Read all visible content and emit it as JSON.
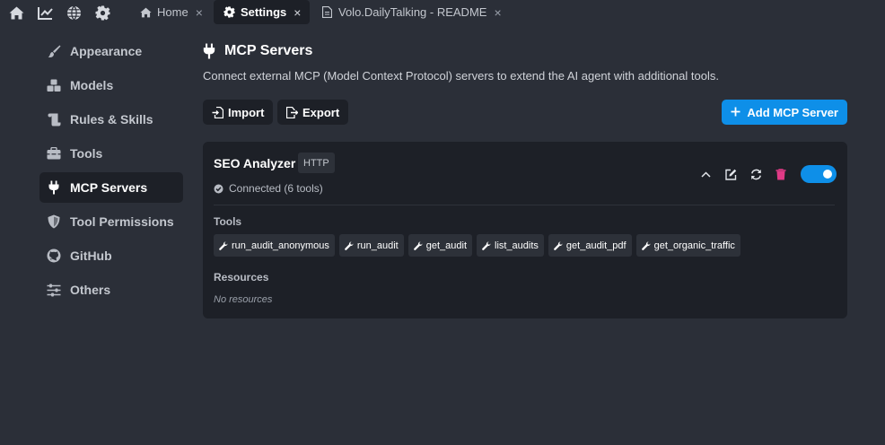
{
  "topbar": {
    "icons": [
      "home-icon",
      "chart-line-icon",
      "globe-icon",
      "gear-icon"
    ],
    "tabs": [
      {
        "label": "Home",
        "icon": "home-icon",
        "active": false
      },
      {
        "label": "Settings",
        "icon": "gear-icon",
        "active": true
      },
      {
        "label": "Volo.DailyTalking - README",
        "icon": "file-icon",
        "active": false
      }
    ],
    "close_glyph": "×"
  },
  "sidebar": {
    "items": [
      {
        "label": "Appearance",
        "icon": "brush-icon"
      },
      {
        "label": "Models",
        "icon": "cubes-icon"
      },
      {
        "label": "Rules & Skills",
        "icon": "scroll-icon"
      },
      {
        "label": "Tools",
        "icon": "toolbox-icon"
      },
      {
        "label": "MCP Servers",
        "icon": "plug-icon"
      },
      {
        "label": "Tool Permissions",
        "icon": "shield-icon"
      },
      {
        "label": "GitHub",
        "icon": "github-icon"
      },
      {
        "label": "Others",
        "icon": "sliders-icon"
      }
    ],
    "active_index": 4
  },
  "main": {
    "title": "MCP Servers",
    "description": "Connect external MCP (Model Context Protocol) servers to extend the AI agent with additional tools.",
    "buttons": {
      "import": "Import",
      "export": "Export",
      "add": "Add MCP Server"
    }
  },
  "server": {
    "name": "SEO Analyzer",
    "transport": "HTTP",
    "status": "Connected (6 tools)",
    "enabled": true,
    "tools_label": "Tools",
    "tools": [
      "run_audit_anonymous",
      "run_audit",
      "get_audit",
      "list_audits",
      "get_audit_pdf",
      "get_organic_traffic"
    ],
    "resources_label": "Resources",
    "resources_empty": "No resources"
  },
  "colors": {
    "background": "#2b2f38",
    "panel": "#1d2027",
    "accent": "#0e8fe8",
    "danger": "#e03a86",
    "status_ok": "#b8bcc4"
  }
}
